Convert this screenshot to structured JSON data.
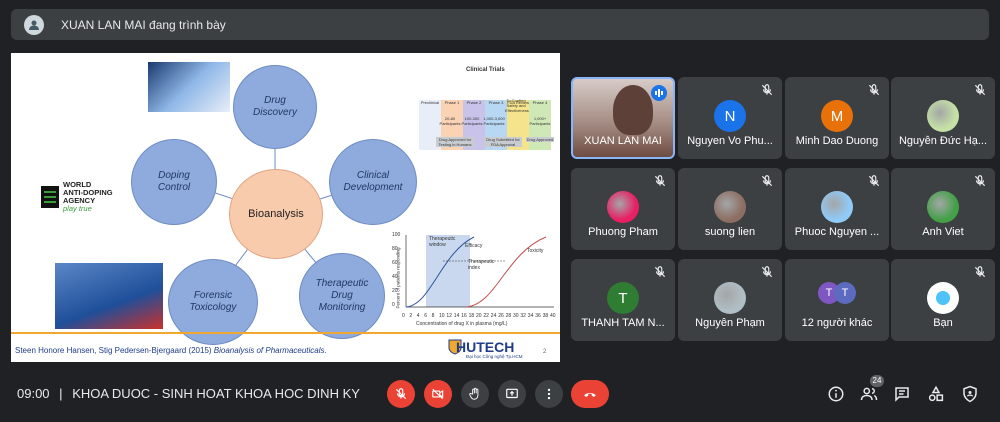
{
  "presenter": {
    "label": "XUAN LAN MAI đang trình bày"
  },
  "slide": {
    "center": "Bioanalysis",
    "bubbles": {
      "drug_discovery": "Drug Discovery",
      "clinical_development": "Clinical Development",
      "therapeutic_monitoring": "Therapeutic Drug Monitoring",
      "forensic": "Forensic Toxicology",
      "doping": "Doping Control"
    },
    "wada": {
      "line1": "WORLD",
      "line2": "ANTI-DOPING",
      "line3": "AGENCY",
      "tagline": "play true"
    },
    "clinical_trials": {
      "title": "Clinical Trials",
      "phases": [
        "Preclinical",
        "Phase 1",
        "Phase 2",
        "Phase 3",
        "FDA Review",
        "Phase 4"
      ],
      "participants": [
        "20-80 Participants",
        "100-300 Participants",
        "1,000-3,000 Participants",
        "To Confirm Safety and Effectiveness",
        "1,000+ Participants"
      ],
      "approvals": [
        "Drug Approved for Testing in Humans",
        "Drug Submitted for FDA Approval",
        "Drug Approved"
      ]
    },
    "chart": {
      "ylabel": "Percent of patients responding",
      "xlabel": "Concentration of drug X in plasma (mg/L)",
      "therapeutic_window": "Therapeutic window",
      "efficacy": "Efficacy",
      "therapeutic_index": "Therapeutic index",
      "toxicity": "Toxicity",
      "yticks": [
        "100",
        "80",
        "60",
        "40",
        "20",
        "0"
      ],
      "xticks": [
        "0",
        "2",
        "4",
        "6",
        "8",
        "10",
        "12",
        "14",
        "16",
        "18",
        "20",
        "22",
        "24",
        "26",
        "28",
        "30",
        "32",
        "34",
        "36",
        "38",
        "40"
      ]
    },
    "citation": {
      "text": "Steen Honore Hansen, Stig Pedersen-Bjergaard (2015) ",
      "book": "Bioanalysis of Pharmaceuticals."
    },
    "logo": {
      "name": "HUTECH",
      "sub": "Đại học Công nghệ Tp.HCM"
    },
    "page_number": "2"
  },
  "participants": [
    {
      "name": "XUAN LAN MAI",
      "initial": "",
      "color": "#8d6e63"
    },
    {
      "name": "Nguyen Vo Phu...",
      "initial": "N",
      "color": "#1a73e8"
    },
    {
      "name": "Minh Dao Duong",
      "initial": "M",
      "color": "#e8710a"
    },
    {
      "name": "Nguyễn Đức Hạ...",
      "initial": "",
      "color": "#c5e1a5"
    },
    {
      "name": "Phuong Pham",
      "initial": "",
      "color": "#e91e63"
    },
    {
      "name": "suong lien",
      "initial": "",
      "color": "#8d6e63"
    },
    {
      "name": "Phuoc Nguyen ...",
      "initial": "",
      "color": "#90caf9"
    },
    {
      "name": "Anh Viet",
      "initial": "",
      "color": "#43a047"
    },
    {
      "name": "THANH TAM N...",
      "initial": "T",
      "color": "#2e7d32"
    },
    {
      "name": "Nguyên Phạm",
      "initial": "",
      "color": "#b0bec5"
    },
    {
      "name": "12 người khác",
      "initial_a": "T",
      "initial_b": "T",
      "color": "#7e57c2"
    },
    {
      "name": "Bạn",
      "initial": "",
      "color": "#ffffff"
    }
  ],
  "meeting": {
    "time": "09:00",
    "separator": "|",
    "title": "KHOA DUOC - SINH HOAT KHOA HOC DINH KY"
  },
  "people_count": "24",
  "colors": {
    "background": "#202124",
    "tile": "#3c4043",
    "red": "#ea4335",
    "accent": "#8ab4f8"
  },
  "controls": [
    "mic-off-icon",
    "camera-off-icon",
    "raise-hand-icon",
    "present-icon",
    "more-options-icon",
    "end-call-icon"
  ],
  "right_controls": [
    "info-icon",
    "people-icon",
    "chat-icon",
    "activities-icon",
    "host-controls-icon"
  ]
}
